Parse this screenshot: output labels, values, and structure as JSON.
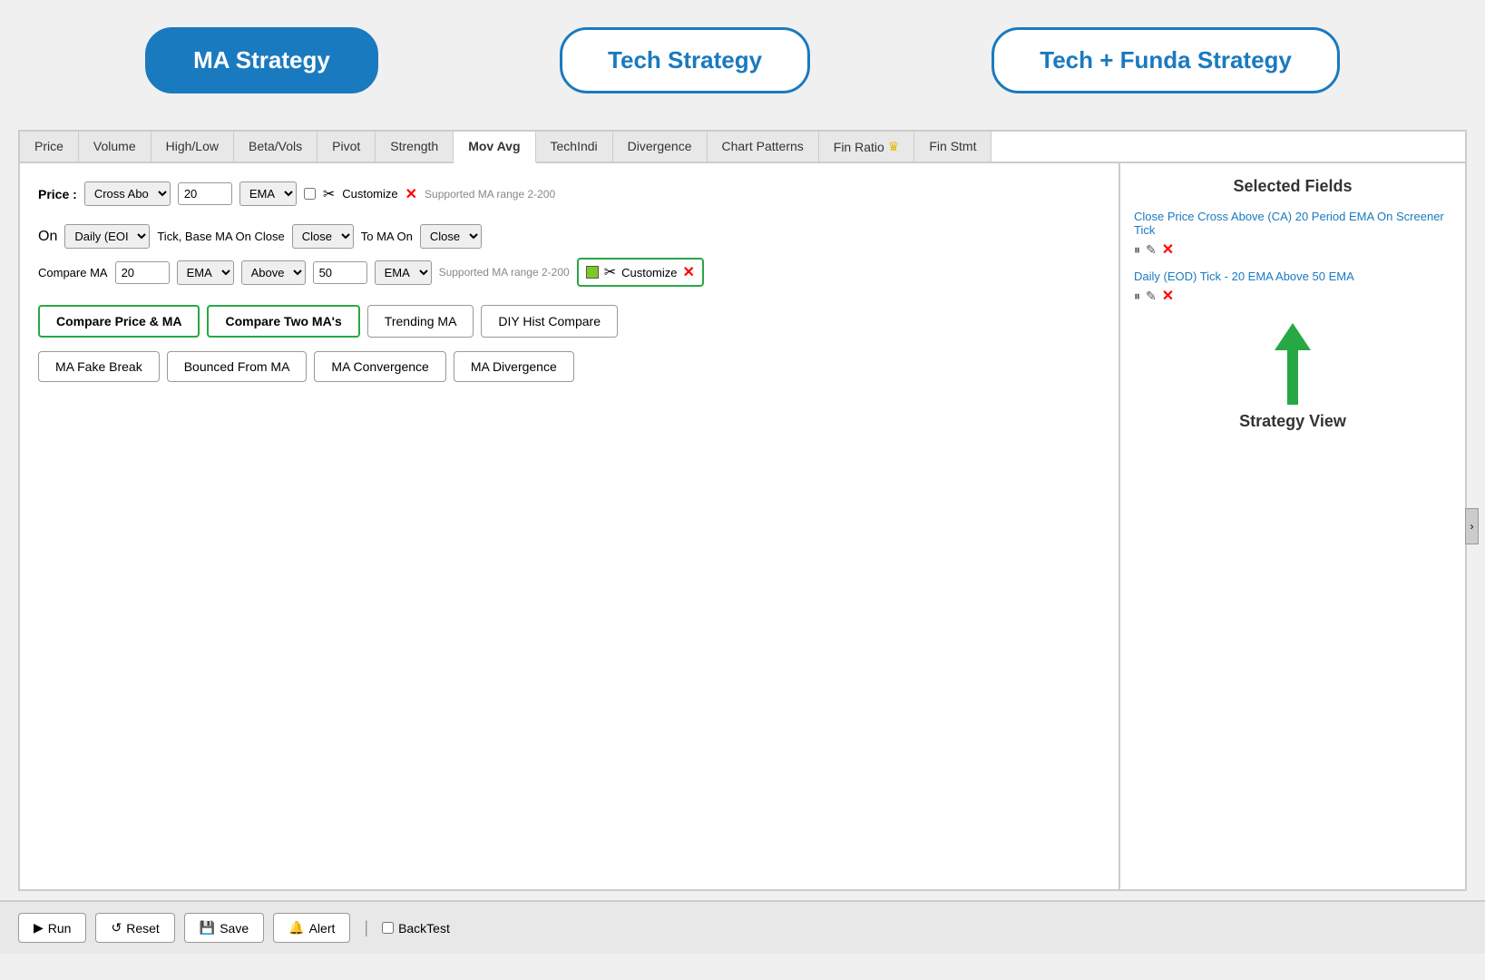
{
  "header": {
    "btn1_label": "MA Strategy",
    "btn2_label": "Tech Strategy",
    "btn3_label": "Tech + Funda Strategy"
  },
  "tabs": [
    {
      "label": "Price",
      "active": false
    },
    {
      "label": "Volume",
      "active": false
    },
    {
      "label": "High/Low",
      "active": false
    },
    {
      "label": "Beta/Vols",
      "active": false
    },
    {
      "label": "Pivot",
      "active": false
    },
    {
      "label": "Strength",
      "active": false
    },
    {
      "label": "Mov Avg",
      "active": true
    },
    {
      "label": "TechIndi",
      "active": false
    },
    {
      "label": "Divergence",
      "active": false
    },
    {
      "label": "Chart Patterns",
      "active": false
    },
    {
      "label": "Fin Ratio",
      "active": false,
      "has_crown": true
    },
    {
      "label": "Fin Stmt",
      "active": false
    }
  ],
  "right_panel": {
    "title": "Selected Fields",
    "field1_text": "Close Price Cross Above (CA) 20 Period EMA On Screener Tick",
    "field2_text": "Daily (EOD) Tick - 20 EMA Above 50 EMA",
    "strategy_view_label": "Strategy View"
  },
  "price_row": {
    "label": "Price :",
    "select1_value": "Cross Abo",
    "input1_value": "20",
    "select2_value": "EMA",
    "customize_label": "Customize",
    "supported_text": "Supported MA range 2-200"
  },
  "on_row": {
    "on_label": "On",
    "select_tick": "Daily (EOI",
    "tick_base_label": "Tick, Base MA On Close",
    "select_base": "Close",
    "to_ma_label": "To MA On",
    "select_to": "Close"
  },
  "compare_ma_row": {
    "label": "Compare MA",
    "input1_value": "20",
    "select1_value": "EMA",
    "select2_value": "Above",
    "input2_value": "50",
    "select3_value": "EMA",
    "supported_text": "Supported MA range 2-200",
    "customize_label": "Customize"
  },
  "btn_row1": {
    "btn1": "Compare Price & MA",
    "btn2": "Compare Two MA's",
    "btn3": "Trending MA",
    "btn4": "DIY Hist Compare"
  },
  "btn_row2": {
    "btn1": "MA Fake Break",
    "btn2": "Bounced From MA",
    "btn3": "MA Convergence",
    "btn4": "MA Divergence"
  },
  "toolbar": {
    "run_label": "Run",
    "reset_label": "Reset",
    "save_label": "Save",
    "alert_label": "Alert",
    "backtest_label": "BackTest"
  }
}
